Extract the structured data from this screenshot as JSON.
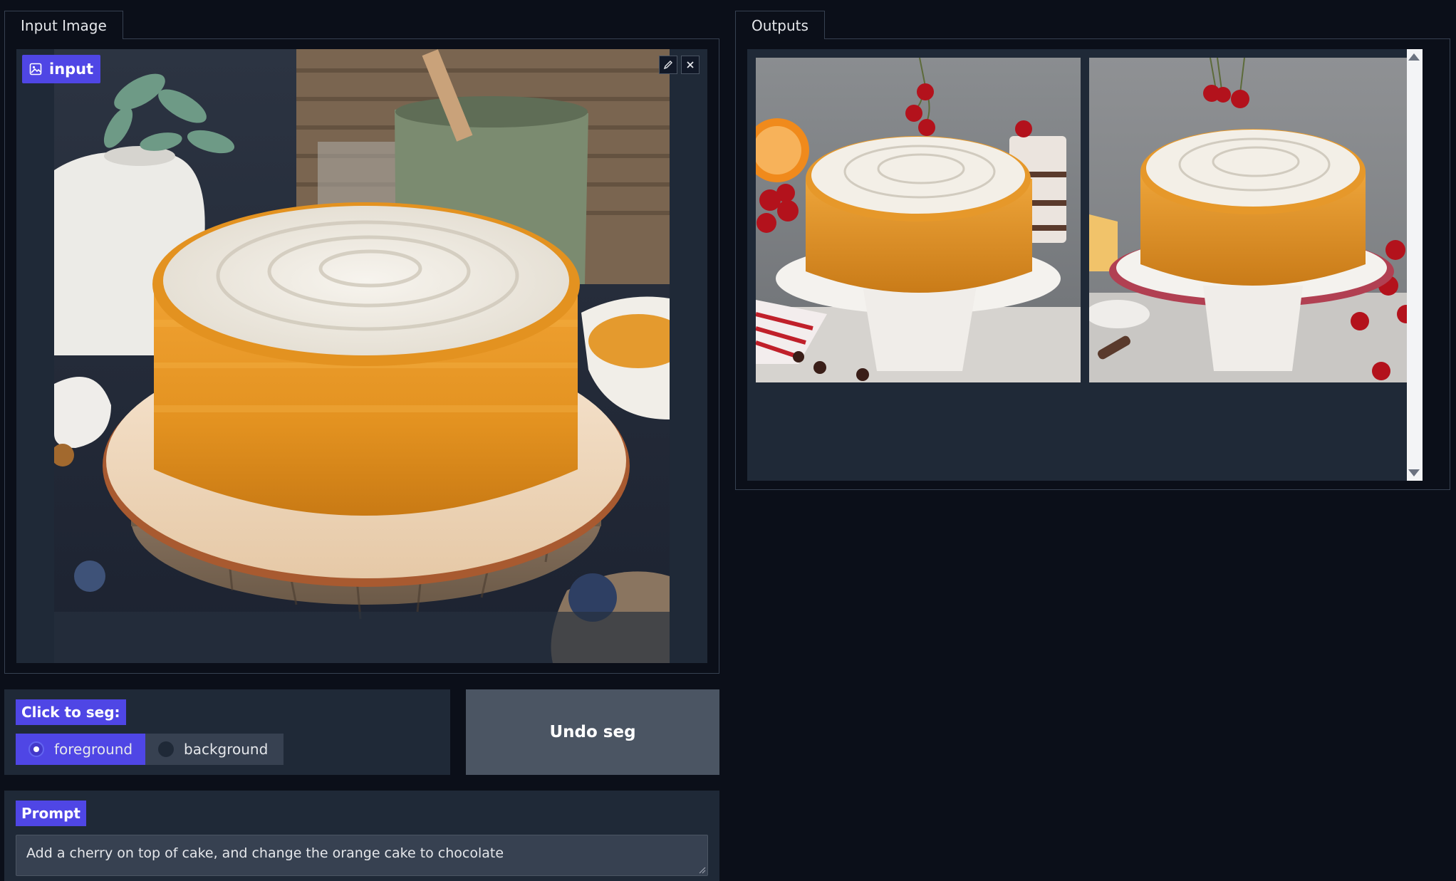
{
  "input_tab": {
    "label": "Input Image"
  },
  "input_image": {
    "badge_label": "input",
    "badge_icon": "image-icon",
    "edit_icon": "pencil-icon",
    "clear_icon": "close-icon"
  },
  "outputs_tab": {
    "label": "Outputs"
  },
  "seg": {
    "label": "Click to seg:",
    "options": [
      {
        "label": "foreground",
        "selected": true
      },
      {
        "label": "background",
        "selected": false
      }
    ],
    "undo_label": "Undo seg"
  },
  "prompt": {
    "label": "Prompt",
    "value": "Add a cherry on top of cake, and change the orange cake to chocolate"
  },
  "colors": {
    "page_bg": "#0b0f19",
    "panel_bg": "#1f2937",
    "accent": "#4f46e5",
    "button_bg": "#4b5563"
  }
}
